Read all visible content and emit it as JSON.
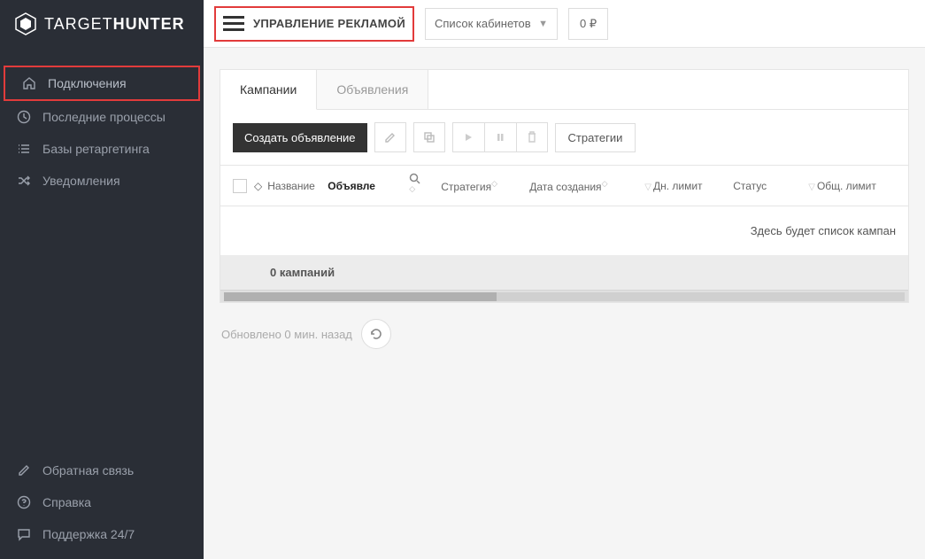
{
  "brand": {
    "thin": "TARGET",
    "bold": "HUNTER"
  },
  "sidebar": {
    "items": [
      {
        "label": "Подключения"
      },
      {
        "label": "Последние процессы"
      },
      {
        "label": "Базы ретаргетинга"
      },
      {
        "label": "Уведомления"
      }
    ],
    "bottom": [
      {
        "label": "Обратная связь"
      },
      {
        "label": "Справка"
      },
      {
        "label": "Поддержка 24/7"
      }
    ]
  },
  "topbar": {
    "title": "УПРАВЛЕНИЕ РЕКЛАМОЙ",
    "dropdown": "Список кабинетов",
    "balance": "0 ₽"
  },
  "tabs": {
    "campaigns": "Кампании",
    "ads": "Объявления"
  },
  "toolbar": {
    "create": "Создать объявление",
    "strategies": "Стратегии"
  },
  "columns": {
    "name": "Название",
    "ad": "Объявле",
    "strategy": "Стратегия",
    "created": "Дата создания",
    "daylimit": "Дн. лимит",
    "status": "Статус",
    "totlimit": "Общ. лимит"
  },
  "table": {
    "empty": "Здесь будет список кампан",
    "summary": "0 кампаний"
  },
  "updated": "Обновлено 0 мин. назад"
}
